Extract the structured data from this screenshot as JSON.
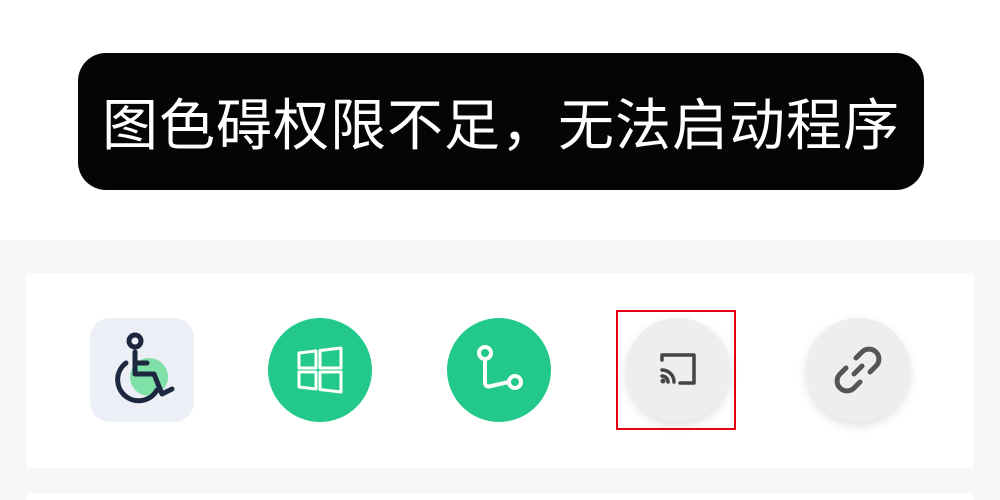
{
  "toast": {
    "message": "图色碍权限不足，无法启动程序"
  },
  "colors": {
    "toast_bg": "#050505",
    "panel_bg": "#f7f7f7",
    "green_accent": "#22c98a",
    "accessibility_tile_bg": "#eceff5",
    "gray_button_bg": "#eeeeee",
    "highlight": "#e60012"
  },
  "quick_actions": [
    {
      "icon": "accessibility-icon",
      "shape": "rounded-square",
      "background": "#eceff5"
    },
    {
      "icon": "windows-icon",
      "shape": "circle",
      "background": "#22c98a"
    },
    {
      "icon": "branch-connection-icon",
      "shape": "circle",
      "background": "#22c98a"
    },
    {
      "icon": "cast-screen-icon",
      "shape": "circle",
      "background": "#eeeeee",
      "highlighted": true
    },
    {
      "icon": "link-icon",
      "shape": "circle",
      "background": "#eeeeee"
    }
  ]
}
